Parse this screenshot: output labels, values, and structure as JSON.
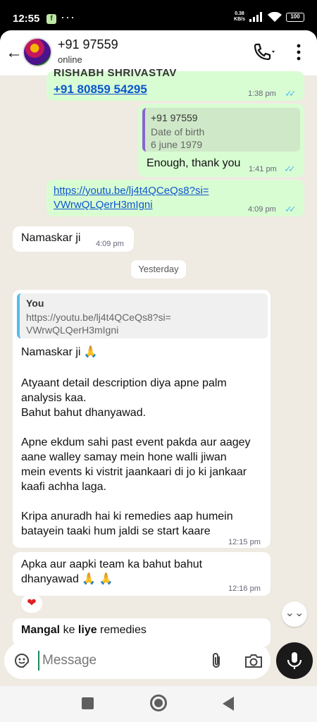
{
  "status_bar": {
    "time": "12:55",
    "app_badge": "f",
    "more": "···",
    "net_speed_value": "0.38",
    "net_speed_unit": "KB/s",
    "battery": "100"
  },
  "header": {
    "contact_name": "+91 97559",
    "status": "online",
    "back_icon": "arrow-left-icon",
    "call_icon": "phone-icon",
    "menu_icon": "kebab-menu-icon"
  },
  "messages": {
    "m1": {
      "name_partial": "RISHABH SHRIVASTAV",
      "phone_link": "+91 80859 54295",
      "time": "1:38 pm",
      "ticks": "✓✓"
    },
    "m2": {
      "quote_name": "+91 97559",
      "quote_line1": "Date of birth",
      "quote_line2": "6 june 1979",
      "text": "Enough, thank you",
      "time": "1:41 pm",
      "ticks": "✓✓"
    },
    "m3": {
      "link_line1": "https://youtu.be/lj4t4QCeQs8?si=",
      "link_line2": "VWrwQLQerH3mIgni",
      "time": "4:09 pm",
      "ticks": "✓✓"
    },
    "m4": {
      "text": "Namaskar ji",
      "time": "4:09 pm"
    },
    "date_separator": "Yesterday",
    "m5": {
      "quote_author": "You",
      "quote_line1": "https://youtu.be/lj4t4QCeQs8?si=",
      "quote_line2": "VWrwQLQerH3mIgni",
      "line1": "Namaskar ji 🙏",
      "line2": "Atyaant detail description diya apne palm",
      "line3": "analysis kaa.",
      "line4": "Bahut bahut dhanyawad.",
      "line5": "Apne ekdum sahi past event pakda aur aagey",
      "line6": "aane walley samay mein hone walli jiwan",
      "line7": "mein events ki vistrit jaankaari di jo ki jankaar",
      "line8": "kaafi achha laga.",
      "line9": "Kripa anuradh hai ki remedies aap humein",
      "line10": "batayein taaki hum jaldi se start kaare",
      "time": "12:15 pm"
    },
    "m6": {
      "line1": "Apka aur aapki team ka bahut bahut",
      "line2": "dhanyawad 🙏 🙏",
      "time": "12:16 pm",
      "reaction": "❤"
    },
    "m7": {
      "bold1": "Mangal",
      "plain1": " ke ",
      "bold2": "liye",
      "plain2": " remedies"
    }
  },
  "scroll_down": "⌄⌄",
  "composer": {
    "placeholder": "Message",
    "emoji_icon": "sticker-icon",
    "attach_icon": "paperclip-icon",
    "camera_icon": "camera-icon",
    "mic_icon": "microphone-icon"
  },
  "colors": {
    "outgoing_bubble": "#d9fdd3",
    "incoming_bubble": "#ffffff",
    "chat_background": "#efeae2",
    "link": "#0b57d0",
    "read_ticks": "#53bdeb",
    "mic_button": "#1a1a1a"
  }
}
